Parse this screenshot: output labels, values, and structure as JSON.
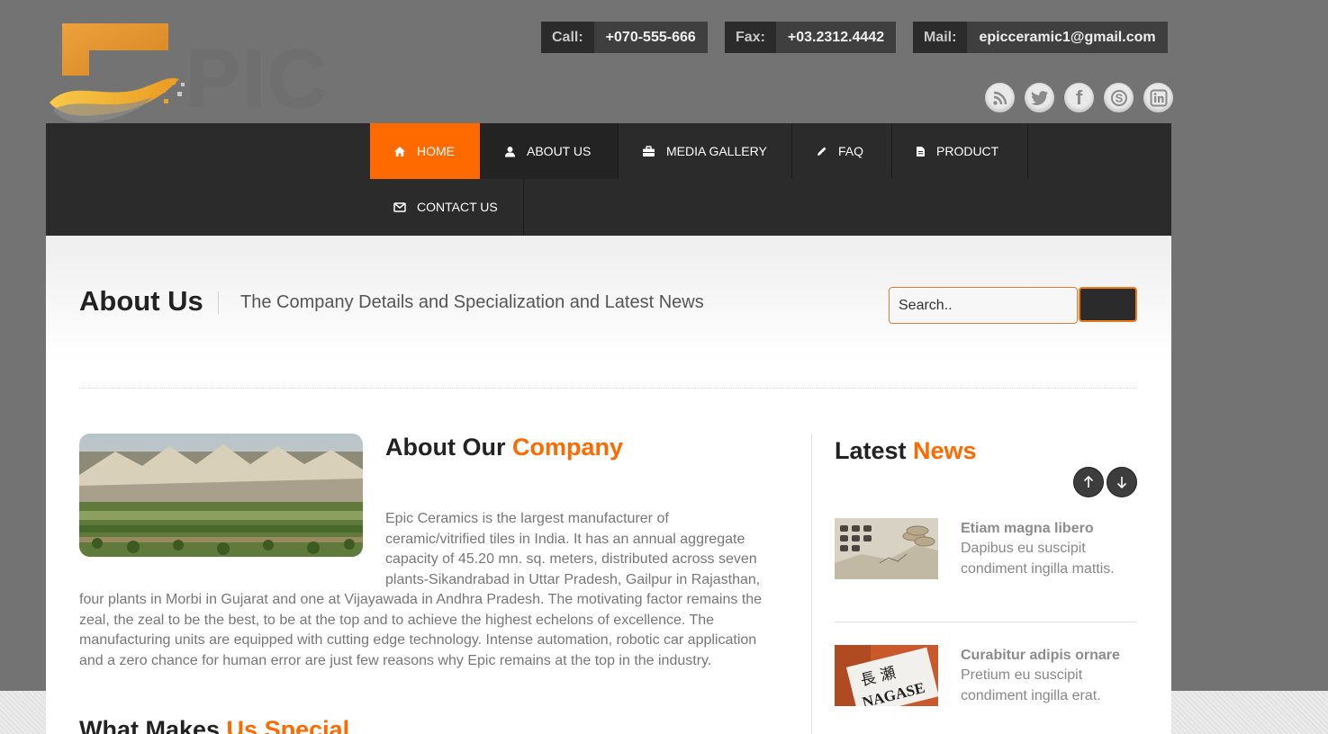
{
  "header": {
    "logo_text": "PIC",
    "contacts": {
      "call": {
        "label": "Call:",
        "value": "+070-555-666"
      },
      "fax": {
        "label": "Fax:",
        "value": "+03.2312.4442"
      },
      "mail": {
        "label": "Mail:",
        "value": "epicceramic1@gmail.com"
      }
    },
    "social_icons": [
      "rss-icon",
      "twitter-icon",
      "facebook-icon",
      "skype-icon",
      "linkedin-icon"
    ]
  },
  "nav": {
    "items": [
      {
        "label": "HOME",
        "icon": "home-icon",
        "active": true
      },
      {
        "label": "ABOUT US",
        "icon": "user-icon"
      },
      {
        "label": "MEDIA GALLERY",
        "icon": "briefcase-icon"
      },
      {
        "label": "FAQ",
        "icon": "pencil-icon"
      },
      {
        "label": "PRODUCT",
        "icon": "document-icon"
      },
      {
        "label": "CONTACT US",
        "icon": "envelope-icon"
      }
    ]
  },
  "page": {
    "title": "About Us",
    "subtitle": "The Company Details and Specialization and Latest News"
  },
  "search": {
    "placeholder": "Search.."
  },
  "about": {
    "heading_main": "About Our ",
    "heading_accent": "Company",
    "text": "Epic Ceramics is the largest manufacturer of ceramic/vitrified tiles in India. It has an annual aggregate capacity of 45.20 mn. sq. meters, distributed across seven plants-Sikandrabad in Uttar Pradesh, Gailpur in Rajasthan, four plants in Morbi in Gujarat and one at Vijayawada in Andhra Pradesh. The motivating factor remains the zeal, the zeal to be the best, to be at the top and to achieve the highest echelons of excellence. The manufacturing units are equipped with cutting edge technology. Intense automation, robotic car application and a zero chance for human error are just few reasons why Epic remains at the top in the industry."
  },
  "special": {
    "heading_main": "What Makes ",
    "heading_accent": "Us Special"
  },
  "news": {
    "heading_main": "Latest ",
    "heading_accent": "News",
    "items": [
      {
        "title": "Etiam magna libero",
        "desc": "Dapibus eu suscipit condiment ingilla mattis."
      },
      {
        "title": "Curabitur adipis ornare",
        "desc": "Pretium eu suscipit condiment ingilla erat."
      }
    ]
  },
  "colors": {
    "accent": "#ff6a00",
    "nav_bg": "#2b2b2b",
    "page_bg": "#737373"
  }
}
